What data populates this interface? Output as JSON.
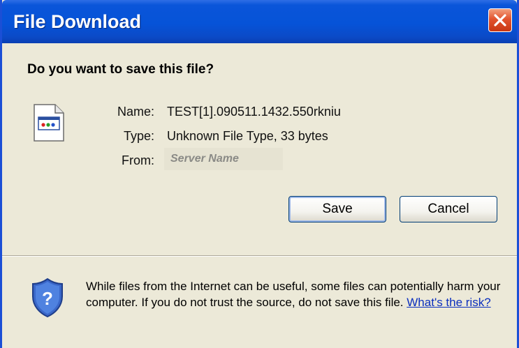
{
  "window": {
    "title": "File Download",
    "close_icon": "close-icon"
  },
  "question": "Do you want to save this file?",
  "file_icon": "file-type-icon",
  "details": {
    "name_label": "Name:",
    "name_value": "TEST[1].090511.1432.550rkniu",
    "type_label": "Type:",
    "type_value": "Unknown File Type, 33 bytes",
    "from_label": "From:",
    "from_value": "Server Name"
  },
  "buttons": {
    "save": "Save",
    "cancel": "Cancel"
  },
  "warning": {
    "icon": "shield-help-icon",
    "text": "While files from the Internet can be useful, some files can potentially harm your computer. If you do not trust the source, do not save this file.",
    "link": "What's the risk?"
  },
  "colors": {
    "titlebar": "#0653d8",
    "dialog_background": "#ece9d8",
    "link": "#0b2fbe",
    "close_button": "#e2532e"
  }
}
